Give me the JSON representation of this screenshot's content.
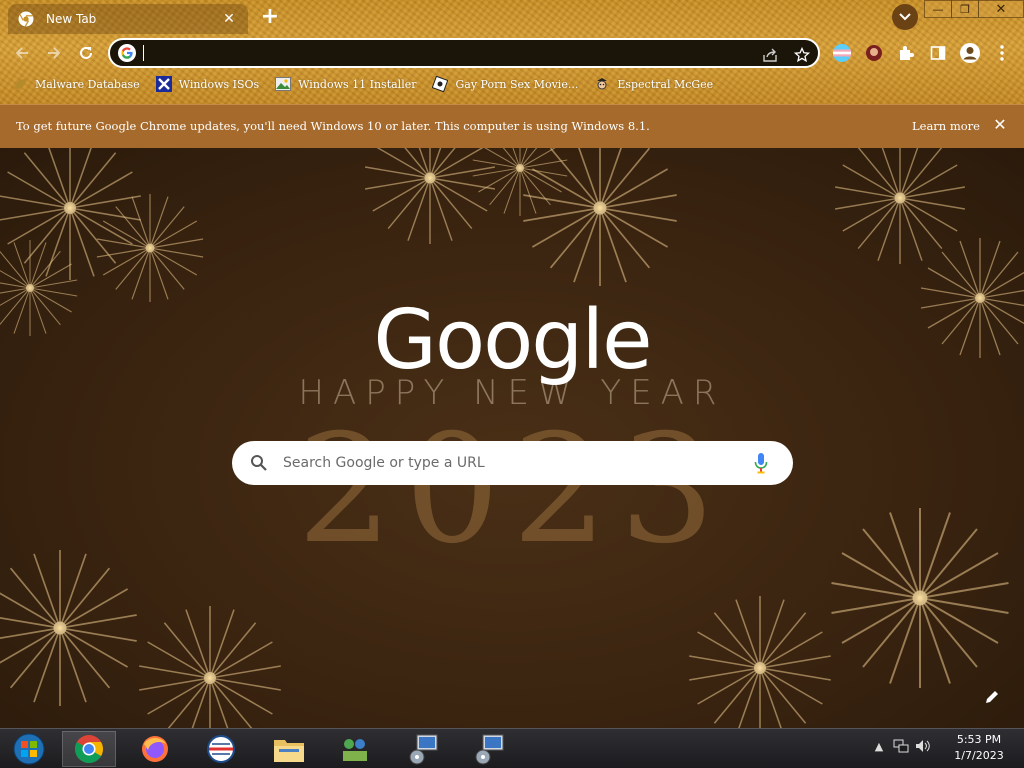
{
  "tab": {
    "title": "New Tab"
  },
  "window_controls": {
    "minimize": "—",
    "restore": "❐",
    "close": "✕"
  },
  "omnibox": {
    "value": "",
    "placeholder": ""
  },
  "bookmarks": [
    {
      "label": "Malware Database",
      "icon": "leaf-icon"
    },
    {
      "label": "Windows ISOs",
      "icon": "x-logo-icon"
    },
    {
      "label": "Windows 11 Installer",
      "icon": "image-icon"
    },
    {
      "label": "Gay Porn Sex Movie...",
      "icon": "tilt-icon"
    },
    {
      "label": "Espectral McGee",
      "icon": "character-icon"
    }
  ],
  "infobar": {
    "message": "To get future Google Chrome updates, you'll need Windows 10 or later. This computer is using Windows 8.1.",
    "learn_more": "Learn more",
    "dismiss": "✕"
  },
  "ntp": {
    "logo": "Google",
    "doodle_line1": "HAPPY NEW YEAR",
    "doodle_line2": "2023",
    "search_placeholder": "Search Google or type a URL"
  },
  "taskbar": {
    "apps": [
      "start-orb",
      "chrome",
      "firefox",
      "opera",
      "file-explorer",
      "network-app",
      "remote-app-1",
      "remote-app-2"
    ],
    "clock_time": "5:53 PM",
    "clock_date": "1/7/2023",
    "tray_expand": "▲"
  },
  "colors": {
    "frame": "#c99028",
    "infobar": "#a66a2c",
    "ntp_bg": "#3a2410",
    "taskbar": "#1c1c1f"
  }
}
